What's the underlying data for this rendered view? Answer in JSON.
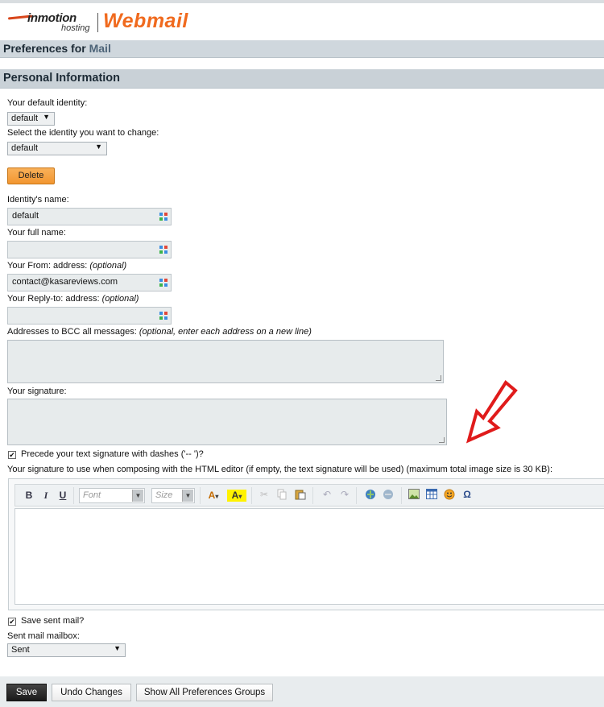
{
  "brand": {
    "company_line1": "inmotion",
    "company_line2": "hosting",
    "product": "Webmail",
    "accent": "#f06a1e"
  },
  "page": {
    "title_prefix": "Preferences for ",
    "title_suffix": "Mail"
  },
  "section": {
    "title": "Personal Information"
  },
  "identity": {
    "default_label": "Your default identity:",
    "default_value": "default",
    "change_label": "Select the identity you want to change:",
    "change_value": "default",
    "delete_label": "Delete"
  },
  "fields": {
    "identity_name_label": "Identity's name:",
    "identity_name_value": "default",
    "full_name_label": "Your full name:",
    "full_name_value": "",
    "from_label": "Your From: address:",
    "from_optional": "(optional)",
    "from_value": "contact@kasareviews.com",
    "reply_label": "Your Reply-to: address:",
    "reply_optional": "(optional)",
    "reply_value": "",
    "bcc_label": "Addresses to BCC all messages:",
    "bcc_hint": "(optional, enter each address on a new line)",
    "signature_label": "Your signature:",
    "dashes_label": "Precede your text signature with dashes ('-- ')?",
    "html_sig_label": "Your signature to use when composing with the HTML editor (if empty, the text signature will be used) (maximum total image size is 30 KB):"
  },
  "editor": {
    "bold": "B",
    "italic": "I",
    "underline": "U",
    "font_placeholder": "Font",
    "size_placeholder": "Size",
    "text_color": "A",
    "bg_color": "A"
  },
  "sent": {
    "save_label": "Save sent mail?",
    "mailbox_label": "Sent mail mailbox:",
    "mailbox_value": "Sent"
  },
  "actions": {
    "save": "Save",
    "undo": "Undo Changes",
    "show_all": "Show All Preferences Groups"
  }
}
